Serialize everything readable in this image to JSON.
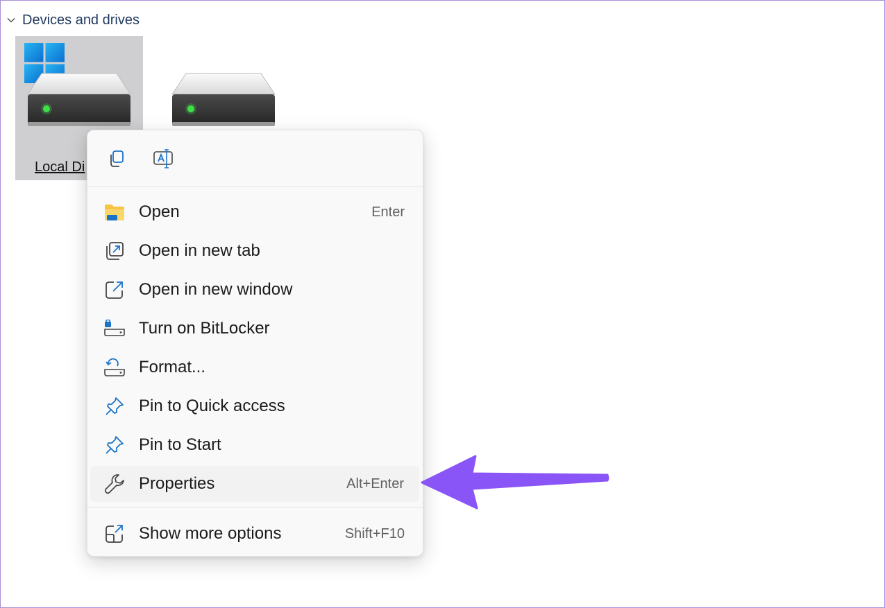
{
  "section": {
    "title": "Devices and drives",
    "chevron_icon": "chevron-down-icon"
  },
  "drives": [
    {
      "label": "Local Di",
      "icon": "hard-drive-icon",
      "has_windows_logo": true,
      "selected": true
    },
    {
      "label": "",
      "icon": "hard-drive-icon",
      "has_windows_logo": false,
      "selected": false
    }
  ],
  "context_menu": {
    "toolbar": [
      {
        "action": "copy",
        "icon": "copy-icon"
      },
      {
        "action": "rename",
        "icon": "rename-icon"
      }
    ],
    "items": [
      {
        "label": "Open",
        "shortcut": "Enter",
        "icon": "folder-icon"
      },
      {
        "label": "Open in new tab",
        "shortcut": "",
        "icon": "new-tab-icon"
      },
      {
        "label": "Open in new window",
        "shortcut": "",
        "icon": "new-window-icon"
      },
      {
        "label": "Turn on BitLocker",
        "shortcut": "",
        "icon": "bitlocker-icon"
      },
      {
        "label": "Format...",
        "shortcut": "",
        "icon": "format-icon"
      },
      {
        "label": "Pin to Quick access",
        "shortcut": "",
        "icon": "pin-icon"
      },
      {
        "label": "Pin to Start",
        "shortcut": "",
        "icon": "pin-icon"
      },
      {
        "label": "Properties",
        "shortcut": "Alt+Enter",
        "icon": "wrench-icon",
        "highlighted": true
      },
      {
        "label": "Show more options",
        "shortcut": "Shift+F10",
        "icon": "more-options-icon"
      }
    ]
  },
  "colors": {
    "accent_arrow": "#8a55f7",
    "selection_bg": "#cfcfd1",
    "folder_yellow": "#f7c546",
    "icon_blue": "#1a73c7"
  }
}
